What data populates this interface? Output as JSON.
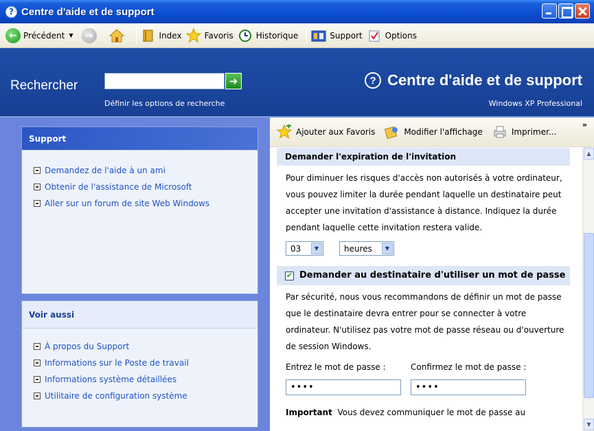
{
  "window": {
    "title": "Centre d'aide et de support"
  },
  "toolbar": {
    "back_label": "Précédent",
    "index_label": "Index",
    "favorites_label": "Favoris",
    "history_label": "Historique",
    "support_label": "Support",
    "options_label": "Options"
  },
  "header": {
    "search_label": "Rechercher",
    "search_value": "",
    "search_options": "Définir les options de recherche",
    "title": "Centre d'aide et de support",
    "subtitle": "Windows XP Professional"
  },
  "left": {
    "support": {
      "title": "Support",
      "items": [
        "Demandez de l'aide à un ami",
        "Obtenir de l'assistance de Microsoft",
        "Aller sur un forum de site Web Windows"
      ]
    },
    "see_also": {
      "title": "Voir aussi",
      "items": [
        "À propos du Support",
        "Informations sur le Poste de travail",
        "Informations système détaillées",
        "Utilitaire de configuration système"
      ]
    }
  },
  "right_toolbar": {
    "add_favorites": "Ajouter aux Favoris",
    "change_view": "Modifier l'affichage",
    "print": "Imprimer...",
    "more": "»"
  },
  "content": {
    "expiration_heading": "Demander l'expiration de l'invitation",
    "expiration_text": "Pour diminuer les risques d'accès non autorisés à votre ordinateur, vous pouvez limiter la durée pendant laquelle un destinataire peut accepter une invitation d'assistance à distance. Indiquez la durée pendant laquelle cette invitation restera valide.",
    "duration_value": "03",
    "unit_value": "heures",
    "password_heading": "Demander au destinataire d'utiliser un mot de passe",
    "password_checked": true,
    "password_text": "Par sécurité, nous vous recommandons de définir un mot de passe que le destinataire devra entrer pour se connecter à votre ordinateur. N'utilisez pas votre mot de passe réseau ou d'ouverture de session Windows.",
    "enter_password_label": "Entrez le mot de passe :",
    "confirm_password_label": "Confirmez le mot de passe :",
    "password_mask": "••••",
    "confirm_mask": "••••",
    "important_label": "Important",
    "important_text": "Vous devez communiquer le mot de passe au"
  }
}
